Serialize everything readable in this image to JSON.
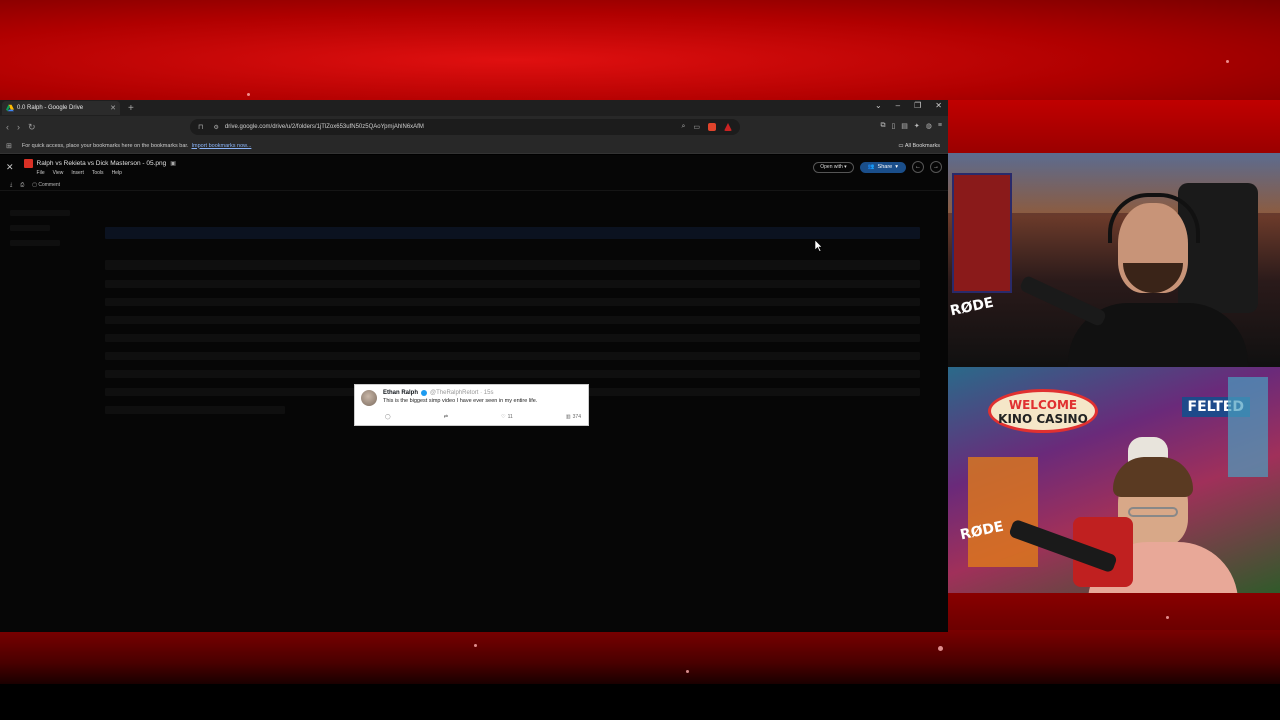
{
  "browser": {
    "tab_title": "0.0 Ralph - Google Drive",
    "new_tab_symbol": "+",
    "url": "drive.google.com/drive/u/2/folders/1jTlZox653ufN50z5QAoYpmjAhlN6xAfM",
    "bookmarks_prompt": "For quick access, place your bookmarks here on the bookmarks bar.",
    "bookmarks_link": "Import bookmarks now...",
    "all_bookmarks": "All Bookmarks"
  },
  "viewer": {
    "file_title": "Ralph vs Rekieta vs Dick Masterson - 05.png",
    "menu": [
      "File",
      "View",
      "Insert",
      "Tools",
      "Help"
    ],
    "open_with": "Open with",
    "share": "Share",
    "comment": "Comment"
  },
  "tweet": {
    "name": "Ethan Ralph",
    "handle": "@TheRalphRetort · 15s",
    "text": "This is the biggest simp video I have ever seen in my entire life.",
    "likes": "11",
    "views": "374"
  },
  "webcams": {
    "cam1_mic_brand": "RØDE",
    "cam2_sign_line1": "WELCOME",
    "cam2_sign_line2": "KINO CASINO",
    "cam2_street_sign": "FELTED",
    "cam2_mic_brand": "RØDE"
  },
  "colors": {
    "stage_red": "#c00000",
    "share_blue": "#1a4e8a",
    "drive_file_red": "#d93025"
  }
}
